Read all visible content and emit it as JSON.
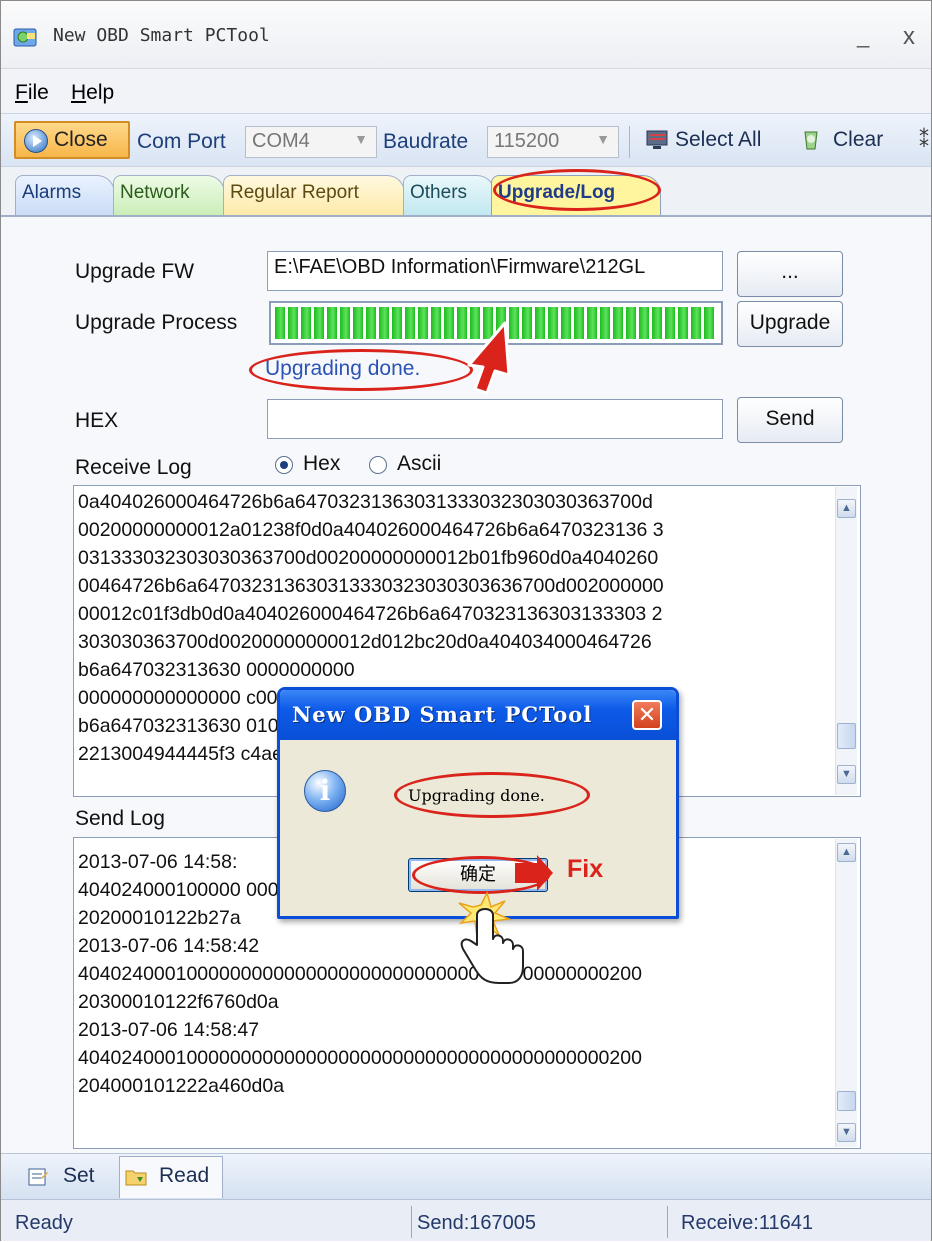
{
  "window": {
    "title": "New OBD Smart PCTool",
    "minimize_glyph": "_",
    "close_glyph": "x"
  },
  "menu": {
    "file": "File",
    "file_mnemonic": "F",
    "file_rest": "ile",
    "help": "Help",
    "help_mnemonic": "H",
    "help_rest": "elp"
  },
  "toolbar": {
    "close_label": "Close",
    "com_port_label": "Com Port",
    "com_port_value": "COM4",
    "baudrate_label": "Baudrate",
    "baudrate_value": "115200",
    "select_all_label": "Select All",
    "clear_label": "Clear"
  },
  "tabs": [
    {
      "label": "Alarms",
      "active": false
    },
    {
      "label": "Network",
      "active": false
    },
    {
      "label": "Regular Report",
      "active": false
    },
    {
      "label": "Others",
      "active": false
    },
    {
      "label": "Upgrade/Log",
      "active": true
    }
  ],
  "upgrade": {
    "fw_label": "Upgrade FW",
    "fw_path": "E:\\FAE\\OBD Information\\Firmware\\212GL",
    "browse_label": "...",
    "process_label": "Upgrade Process",
    "progress": 1.0,
    "upgrade_button": "Upgrade",
    "status": "Upgrading done."
  },
  "hex": {
    "label": "HEX",
    "value": "",
    "send_button": "Send"
  },
  "receive_log": {
    "label": "Receive Log",
    "format_options": [
      "Hex",
      "Ascii"
    ],
    "selected_format": "Hex",
    "lines": [
      "0a404026000464726b6a64703231363031333032303030363700d",
      "00200000000012a01238f0d0a404026000464726b6a6470323136 3",
      "031333032303030363700d00200000000012b01fb960d0a4040260",
      "00464726b6a647032313630313330323030303636700d002000000",
      "00012c01f3db0d0a404026000464726b6a6470323136303133303 2",
      "303030363700d00200000000012d012bc20d0a404034000464726",
      "b6a647032313630                        0000000000",
      "000000000000000                        c000464726",
      "b6a647032313630                        0100000101",
      "2213004944445f3                        c4ae0d0a"
    ]
  },
  "send_log": {
    "label": "Send Log",
    "lines": [
      "2013-07-06 14:58:",
      "404024000100000                        0000000200",
      "20200010122b27a",
      "2013-07-06 14:58:42",
      "4040240001000000000000000000000000000000000000000200",
      "20300010122f6760d0a",
      "2013-07-06 14:58:47",
      "4040240001000000000000000000000000000000000000000200",
      "204000101222a460d0a"
    ]
  },
  "bottom_toolbar": {
    "set_label": "Set",
    "read_label": "Read"
  },
  "statusbar": {
    "ready": "Ready",
    "send": "Send:167005",
    "receive": "Receive:11641"
  },
  "dialog": {
    "title": "New OBD Smart PCTool",
    "close_glyph": "✕",
    "info_glyph": "i",
    "message": "Upgrading done.",
    "ok_button": "确定"
  },
  "annotation": {
    "fix_label": "Fix"
  },
  "colors": {
    "accent_blue": "#0a4dd6",
    "highlight_red": "#d9231b",
    "progress_green": "#1dbb1d"
  }
}
